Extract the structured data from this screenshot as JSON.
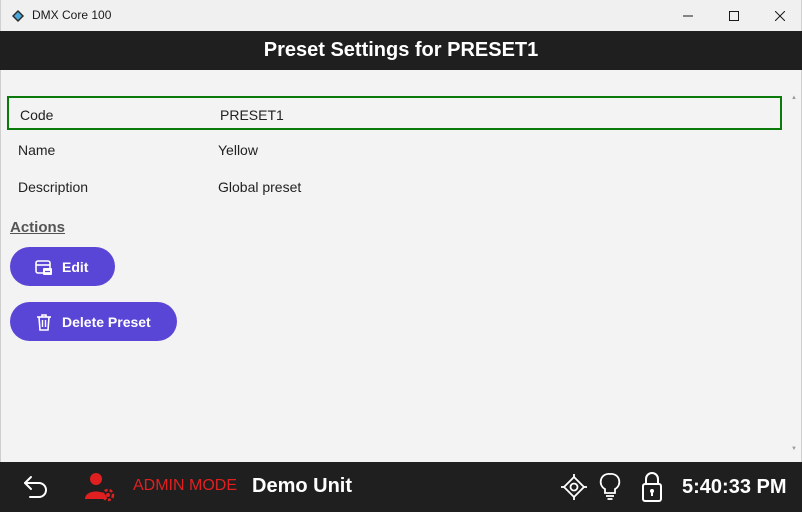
{
  "window": {
    "title": "DMX Core 100",
    "icons": [
      "app-logo-icon",
      "minimize-icon",
      "maximize-icon",
      "close-icon"
    ]
  },
  "header": {
    "title": "Preset Settings for PRESET1"
  },
  "fields": [
    {
      "label": "Code",
      "value": "PRESET1",
      "selected": true
    },
    {
      "label": "Name",
      "value": "Yellow",
      "selected": false
    },
    {
      "label": "Description",
      "value": "Global preset",
      "selected": false
    }
  ],
  "actions": {
    "title": "Actions",
    "edit_label": "Edit",
    "edit_icon": "edit-icon",
    "delete_label": "Delete Preset",
    "delete_icon": "trash-icon",
    "button_color": "#5a46d6"
  },
  "bottombar": {
    "back_icon": "back-arrow-icon",
    "admin_icon": "admin-user-gear-icon",
    "admin_mode": "ADMIN MODE",
    "admin_color": "#e02020",
    "unit_name": "Demo Unit",
    "locate_icon": "locate-icon",
    "bulb_icon": "lightbulb-icon",
    "lock_icon": "lock-icon",
    "time": "5:40:33 PM"
  },
  "colors": {
    "selected_border": "#0a7a0a",
    "bar_background": "#1f1f1f"
  }
}
